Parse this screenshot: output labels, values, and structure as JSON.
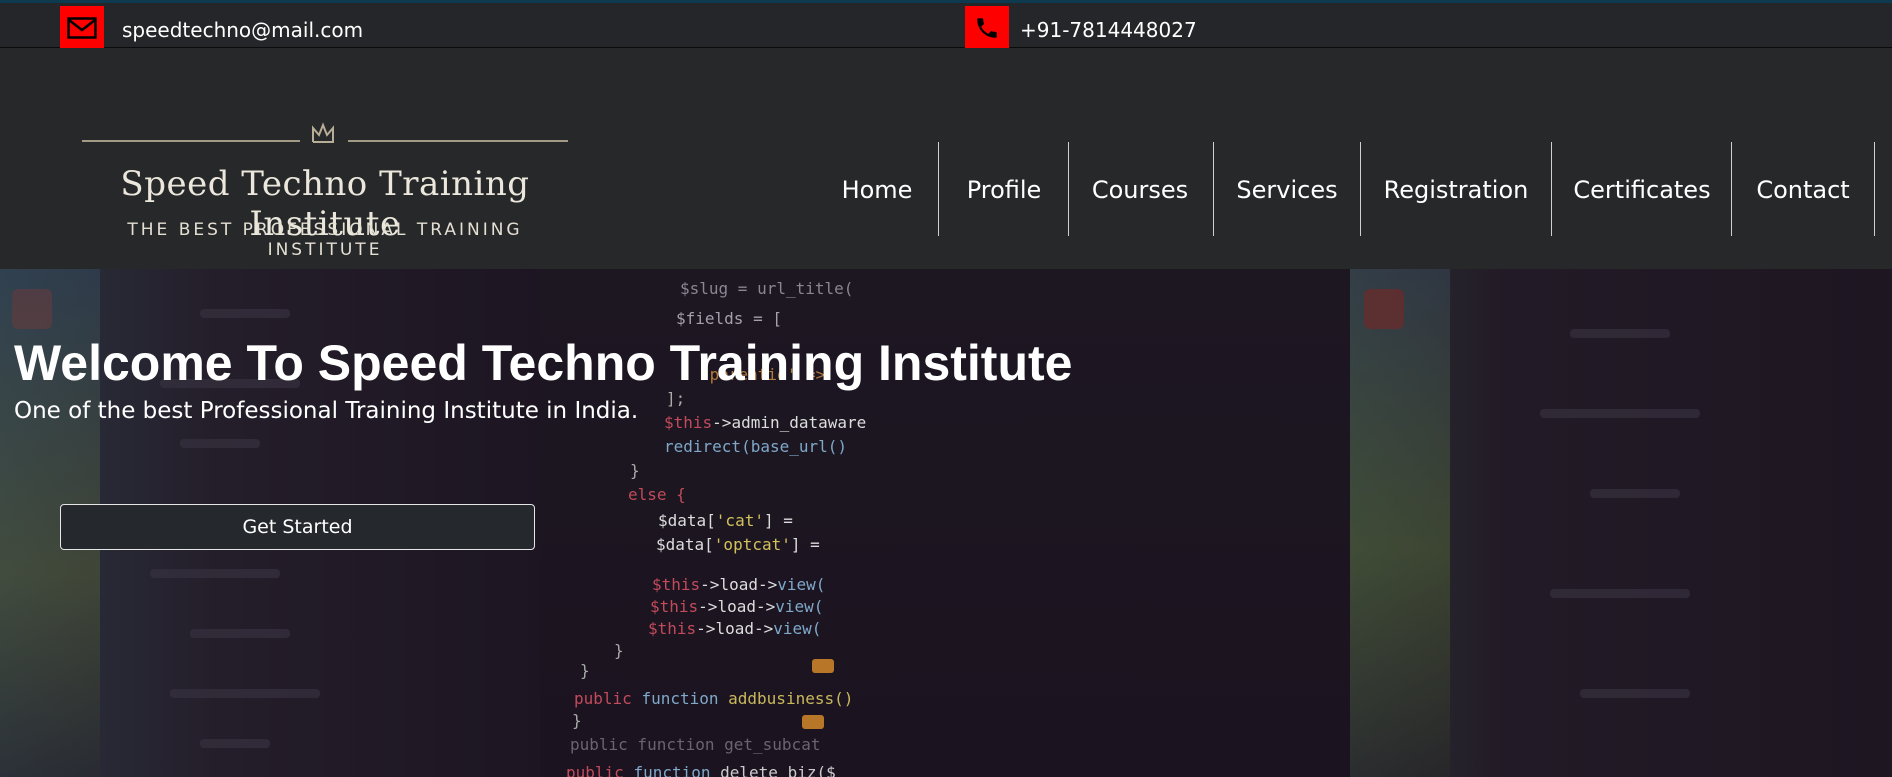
{
  "topbar": {
    "email": "speedtechno@mail.com",
    "phone": "+91-7814448027",
    "icon_bg_color": "#ff0000",
    "email_icon": "envelope-icon",
    "phone_icon": "phone-icon"
  },
  "logo": {
    "title": "Speed Techno Training Institute",
    "subtitle": "THE BEST PROFESSIONAL TRAINING INSTITUTE",
    "icon": "crown-icon"
  },
  "nav": {
    "items": [
      {
        "label": "Home"
      },
      {
        "label": "Profile"
      },
      {
        "label": "Courses"
      },
      {
        "label": "Services"
      },
      {
        "label": "Registration"
      },
      {
        "label": "Certificates"
      },
      {
        "label": "Contact"
      }
    ]
  },
  "hero": {
    "title": "Welcome To Speed Techno Training Institute",
    "subtitle": "One of the best Professional Training Institute in India.",
    "cta_label": "Get Started"
  }
}
